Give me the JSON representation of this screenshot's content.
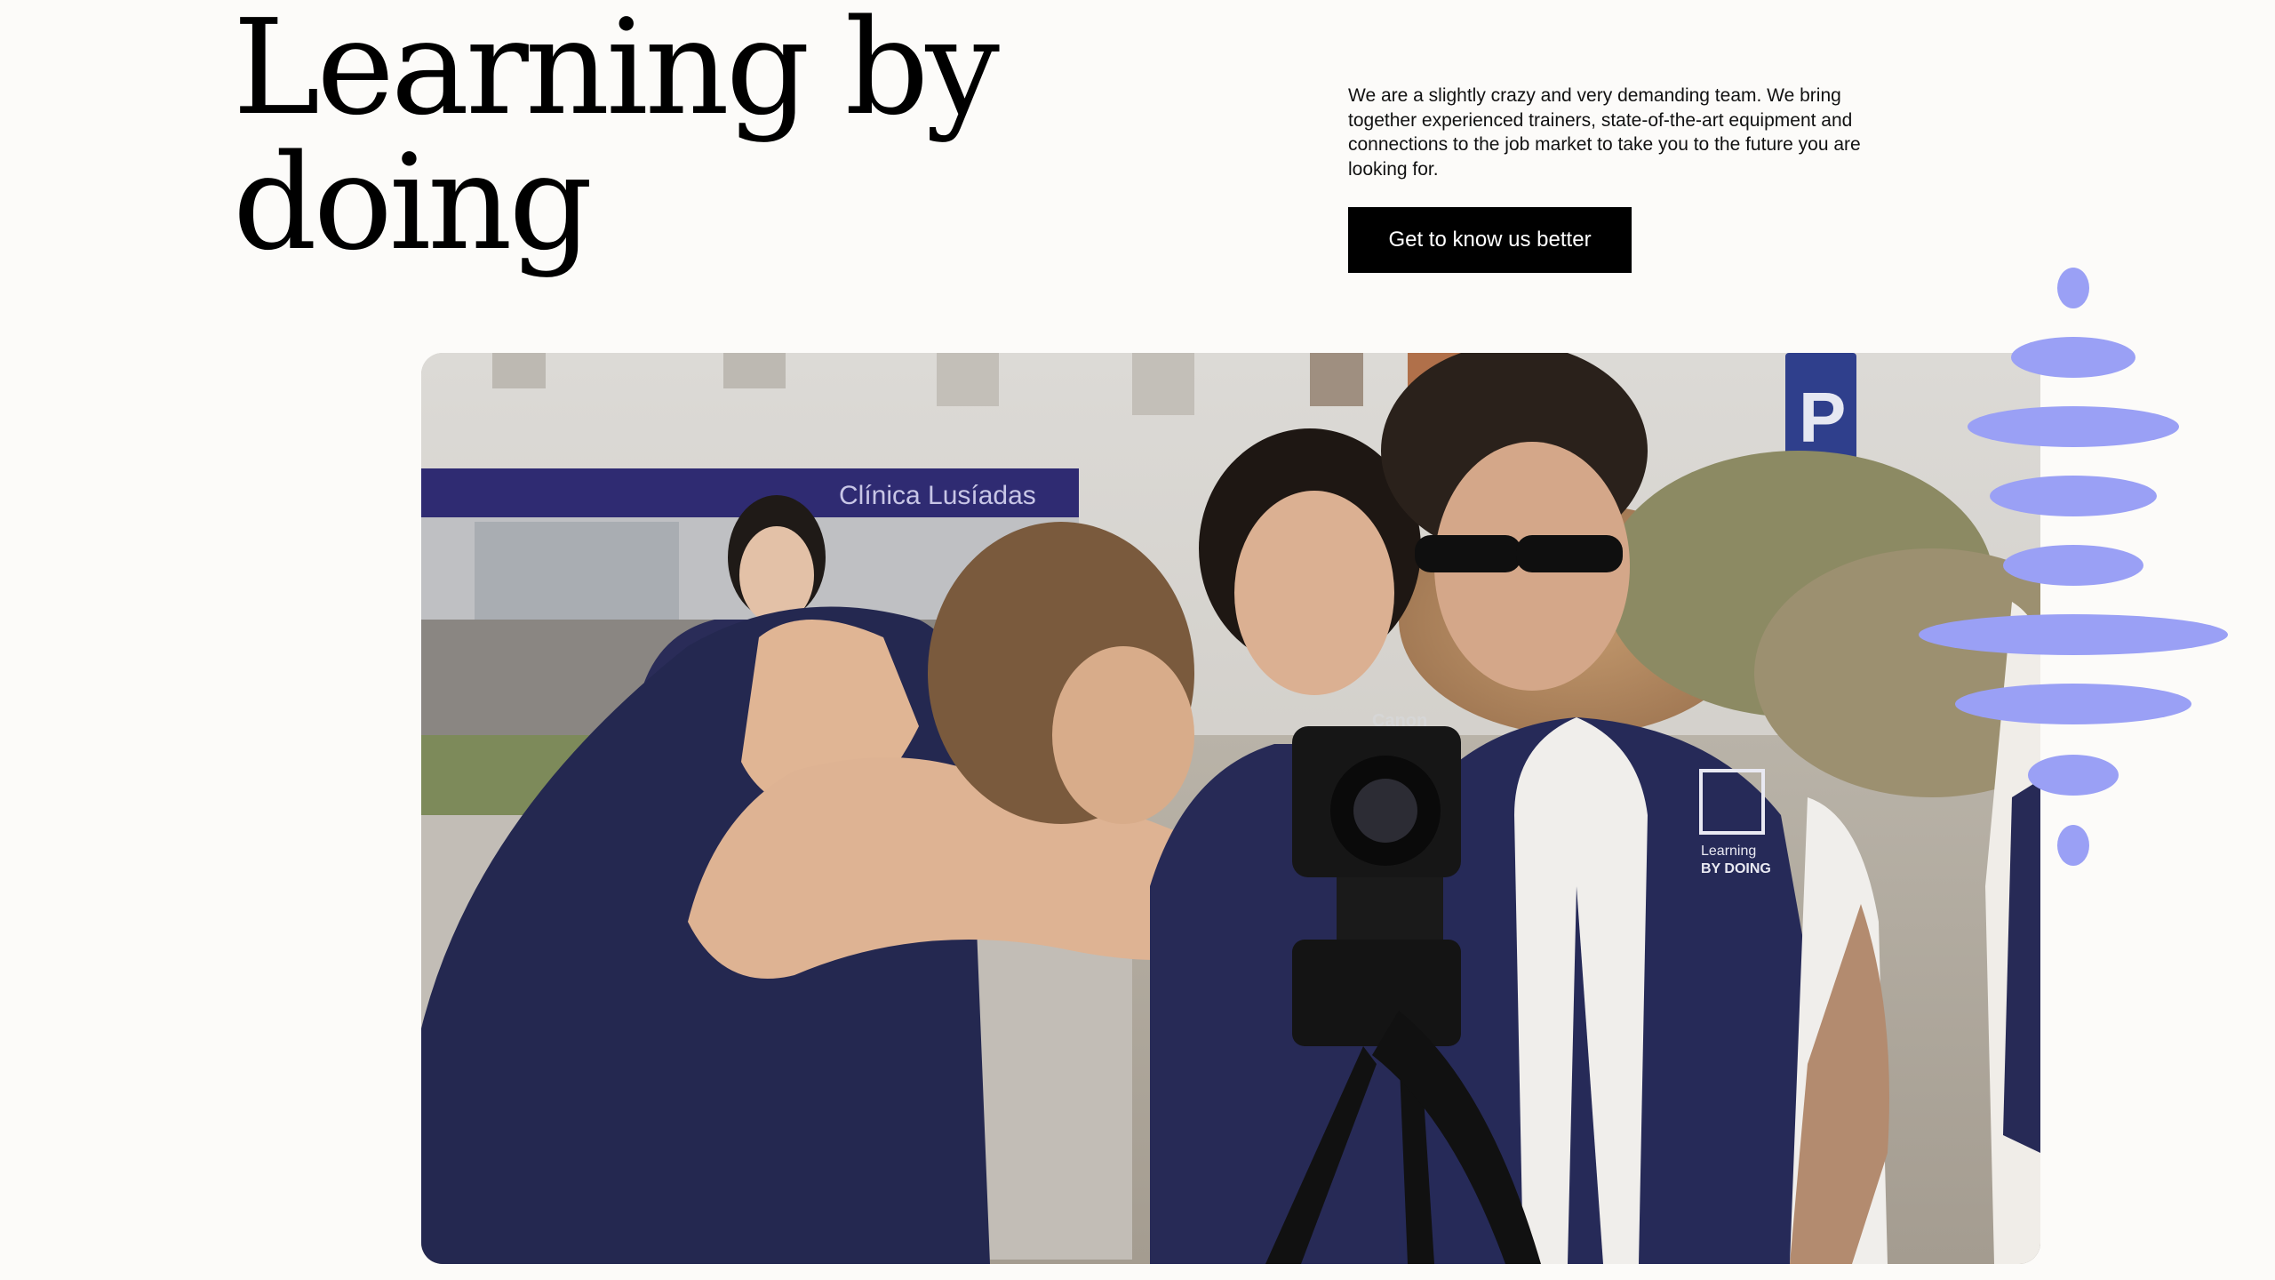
{
  "hero": {
    "title_line1": "Learning by",
    "title_line2": "doing",
    "intro": "We are a slightly crazy and very demanding team. We bring together experienced trainers, state-of-the-art equipment and connections to the job market to take you to the future you are looking for.",
    "cta_label": "Get to know us better"
  },
  "photo": {
    "shop_sign": "Clínica Lusíadas",
    "parking_sign": "P",
    "vest_logo_line1": "Learning",
    "vest_logo_line2": "BY DOING",
    "camera_brand": "Canon"
  },
  "colors": {
    "background": "#fcfbf9",
    "accent_purple": "#9aa0f5",
    "button": "#000000",
    "vest_navy": "#262a55"
  }
}
